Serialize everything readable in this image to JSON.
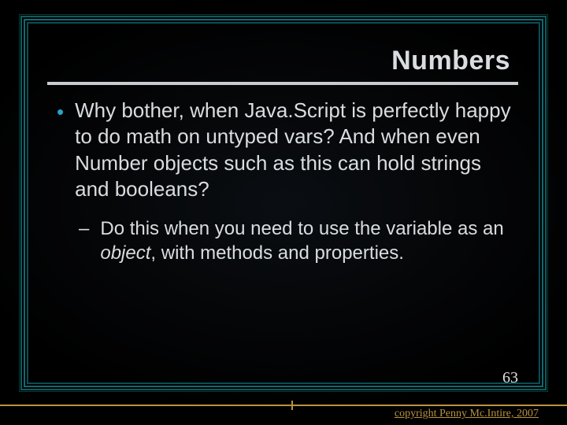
{
  "title": "Numbers",
  "bullets": {
    "main": "Why bother, when Java.Script is perfectly happy to do math on untyped vars? And when even Number objects such as this can hold strings and booleans?",
    "sub_pre": "Do this when you need to use the variable as an ",
    "sub_em": "object",
    "sub_post": ", with methods and properties."
  },
  "page_number": "63",
  "copyright": "copyright Penny Mc.Intire, 2007"
}
